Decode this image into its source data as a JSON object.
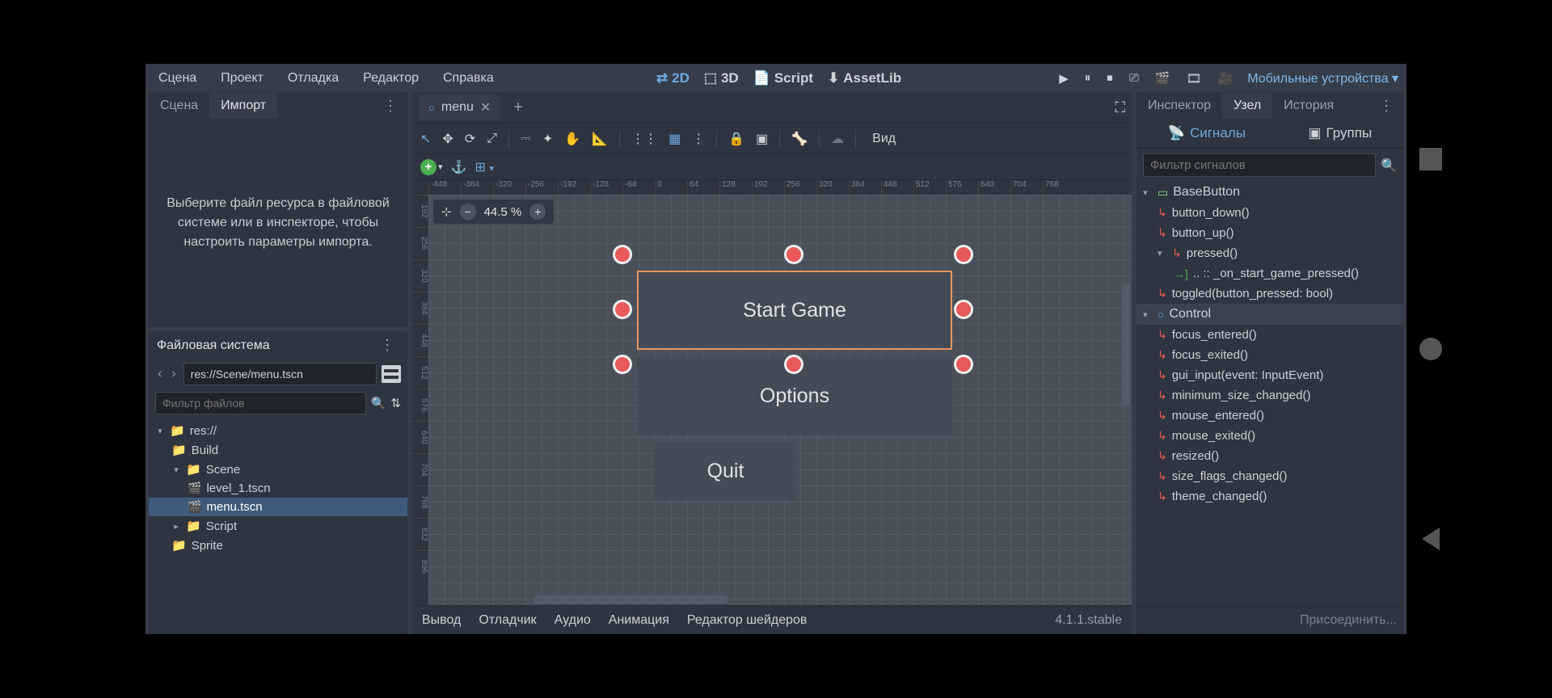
{
  "top_menu": {
    "scene": "Сцена",
    "project": "Проект",
    "debug": "Отладка",
    "editor": "Редактор",
    "help": "Справка"
  },
  "workspace": {
    "w2d": "2D",
    "w3d": "3D",
    "script": "Script",
    "assetlib": "AssetLib"
  },
  "export_target": "Мобильные устройства",
  "left_tabs": {
    "scene": "Сцена",
    "import": "Импорт"
  },
  "import_placeholder": "Выберите файл ресурса в файловой системе или в инспекторе, чтобы настроить параметры импорта.",
  "filesystem": {
    "title": "Файловая система",
    "path": "res://Scene/menu.tscn",
    "filter_placeholder": "Фильтр файлов",
    "root": "res://",
    "folders": [
      "Build",
      "Scene"
    ],
    "scene_files": [
      "level_1.tscn",
      "menu.tscn"
    ],
    "script_folder": "Script",
    "sprite_folder": "Sprite"
  },
  "open_scene": "menu",
  "toolbar": {
    "view": "Вид"
  },
  "viewport": {
    "zoom": "44.5 %",
    "buttons": {
      "start": "Start Game",
      "options": "Options",
      "quit": "Quit"
    }
  },
  "bottom": {
    "output": "Вывод",
    "debugger": "Отладчик",
    "audio": "Аудио",
    "animation": "Анимация",
    "shader": "Редактор шейдеров",
    "version": "4.1.1.stable"
  },
  "right_tabs": {
    "inspector": "Инспектор",
    "node": "Узел",
    "history": "История"
  },
  "signals_groups": {
    "signals": "Сигналы",
    "groups": "Группы"
  },
  "signal_filter_placeholder": "Фильтр сигналов",
  "signal_classes": {
    "basebutton": {
      "name": "BaseButton",
      "signals": [
        "button_down()",
        "button_up()",
        "pressed()",
        "toggled(button_pressed: bool)"
      ],
      "connection": ".. :: _on_start_game_pressed()"
    },
    "control": {
      "name": "Control",
      "signals": [
        "focus_entered()",
        "focus_exited()",
        "gui_input(event: InputEvent)",
        "minimum_size_changed()",
        "mouse_entered()",
        "mouse_exited()",
        "resized()",
        "size_flags_changed()",
        "theme_changed()"
      ]
    }
  },
  "connect_label": "Присоединить..."
}
